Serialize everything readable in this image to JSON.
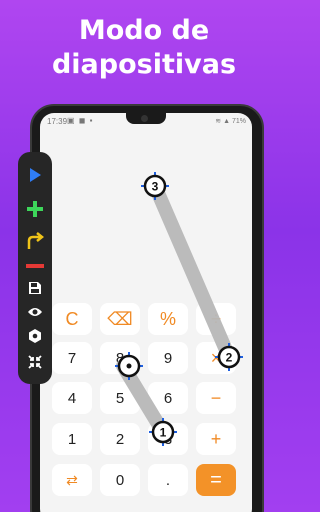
{
  "headline": {
    "line1": "Modo de",
    "line2": "diapositivas"
  },
  "status_bar": {
    "time": "17:39",
    "battery": "71%"
  },
  "keypad": {
    "row1": [
      "C",
      "⌫",
      "%",
      "÷"
    ],
    "row2": [
      "7",
      "8",
      "9",
      "×"
    ],
    "row3": [
      "4",
      "5",
      "6",
      "−"
    ],
    "row4": [
      "1",
      "2",
      "3",
      "+"
    ],
    "row5": [
      "⇄",
      "0",
      ".",
      "="
    ]
  },
  "toolbar": {
    "items": [
      {
        "name": "play-icon",
        "color": "#2f7df6"
      },
      {
        "name": "plus-icon",
        "color": "#3dd65a"
      },
      {
        "name": "redo-arrow-icon",
        "color": "#f0c419"
      },
      {
        "name": "minus-icon",
        "color": "#e53935"
      },
      {
        "name": "save-icon",
        "color": "#ffffff"
      },
      {
        "name": "eye-icon",
        "color": "#ffffff"
      },
      {
        "name": "hexagon-icon",
        "color": "#ffffff"
      },
      {
        "name": "shrink-icon",
        "color": "#ffffff"
      }
    ]
  },
  "markers": {
    "one": "1",
    "two": "2",
    "three": "3"
  },
  "colors": {
    "accent": "#f39228",
    "target_blue": "#1e5fe0",
    "path_gray": "#b8b8b8"
  }
}
